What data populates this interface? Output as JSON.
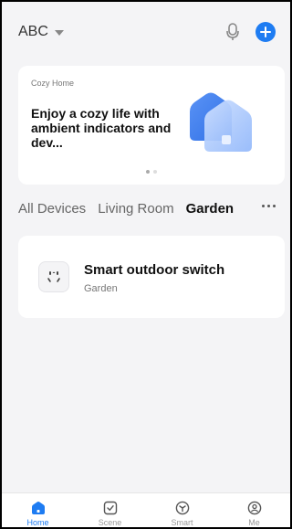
{
  "header": {
    "home_name": "ABC"
  },
  "banner": {
    "eyebrow": "Cozy Home",
    "title": "Enjoy a cozy life with ambient indicators and dev...",
    "page_index": 1,
    "page_count": 2
  },
  "tabs": [
    {
      "label": "All Devices",
      "active": false
    },
    {
      "label": "Living Room",
      "active": false
    },
    {
      "label": "Garden",
      "active": true
    }
  ],
  "device": {
    "name": "Smart outdoor switch",
    "room": "Garden"
  },
  "nav": [
    {
      "label": "Home",
      "icon": "home-icon",
      "active": true
    },
    {
      "label": "Scene",
      "icon": "scene-icon",
      "active": false
    },
    {
      "label": "Smart",
      "icon": "smart-icon",
      "active": false
    },
    {
      "label": "Me",
      "icon": "profile-icon",
      "active": false
    }
  ],
  "colors": {
    "accent": "#1e7cf2",
    "background": "#f4f4f6"
  }
}
